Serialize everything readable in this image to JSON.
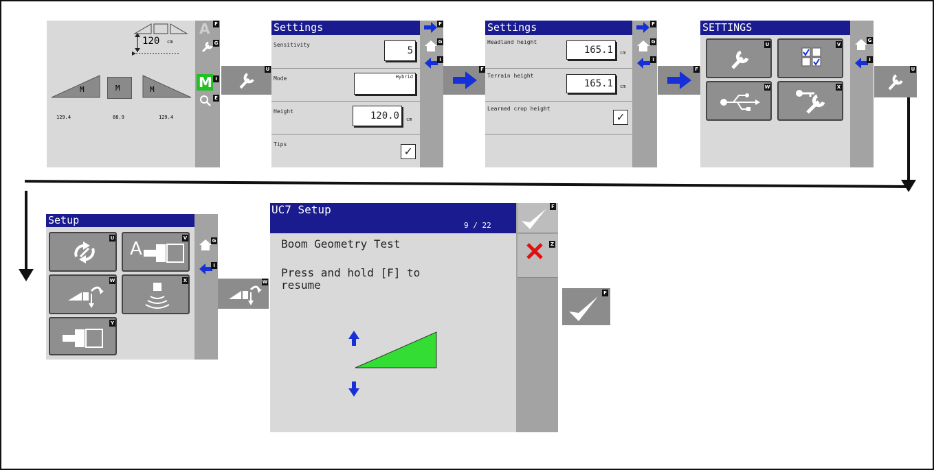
{
  "screen1": {
    "height_value": "120",
    "height_unit": "cm",
    "sections": [
      "M",
      "M",
      "M"
    ],
    "readings": [
      "129.4",
      "88.9",
      "129.4"
    ],
    "side_keys": [
      "F",
      "G",
      "I",
      "E"
    ],
    "auto_label": "A",
    "manual_label": "M"
  },
  "step1": {
    "key": "U"
  },
  "screen2": {
    "title": "Settings",
    "sensitivity_label": "Sensitivity",
    "sensitivity_value": "5",
    "mode_label": "Mode",
    "mode_value": "Hybrid",
    "height_label": "Height",
    "height_value": "120.0",
    "height_unit": "cm",
    "tips_label": "Tips",
    "tips_checked": true,
    "side_keys": [
      "F",
      "G",
      "I"
    ]
  },
  "step2": {
    "key": "F"
  },
  "screen3": {
    "title": "Settings",
    "headland_label": "Headland height",
    "headland_value": "165.1",
    "terrain_label": "Terrain height",
    "terrain_value": "165.1",
    "unit": "cm",
    "learned_label": "Learned crop height",
    "learned_checked": true,
    "side_keys": [
      "F",
      "G",
      "I"
    ]
  },
  "step3": {
    "key": "F"
  },
  "screen4": {
    "title": "SETTINGS",
    "tile_keys": [
      "U",
      "V",
      "W",
      "X"
    ],
    "side_keys": [
      "G",
      "I"
    ]
  },
  "step4": {
    "key": "U"
  },
  "screen5": {
    "title": "Setup",
    "tile_keys": [
      "U",
      "V",
      "W",
      "X",
      "Y"
    ],
    "auto_label": "A",
    "side_keys": [
      "G",
      "I"
    ]
  },
  "step5": {
    "key": "W"
  },
  "screen6": {
    "title": "UC7 Setup",
    "page": "9 / 22",
    "heading": "Boom Geometry Test",
    "instruction_line1": "Press and hold [F] to",
    "instruction_line2": "resume",
    "side_keys": [
      "F",
      "Z"
    ],
    "colors": {
      "triangle": "#33dd33",
      "arrows": "#1530d8",
      "cancel": "#e01010"
    }
  },
  "step6": {
    "key": "F"
  }
}
